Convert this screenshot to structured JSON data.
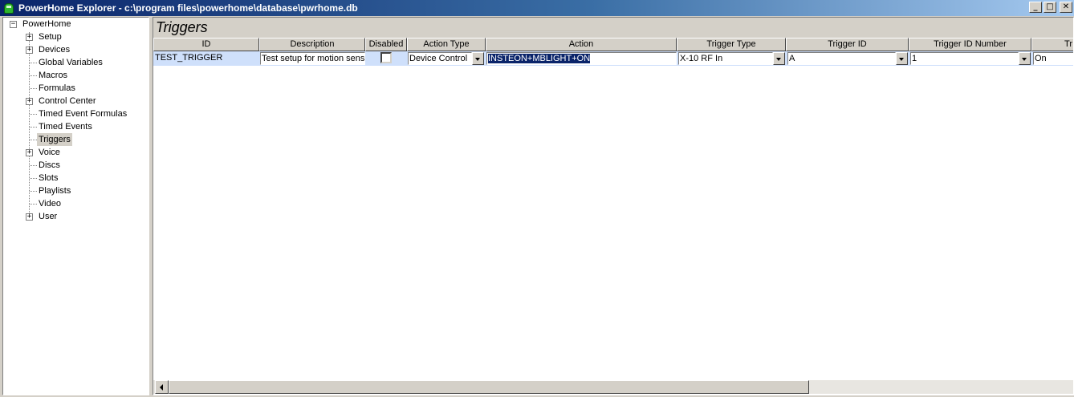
{
  "window": {
    "title": "PowerHome Explorer - c:\\program files\\powerhome\\database\\pwrhome.db",
    "minimize": "_",
    "maximize": "□",
    "close": "✕"
  },
  "tree": {
    "root": "PowerHome",
    "items": [
      {
        "label": "Setup",
        "expandable": true
      },
      {
        "label": "Devices",
        "expandable": true
      },
      {
        "label": "Global Variables",
        "expandable": false
      },
      {
        "label": "Macros",
        "expandable": false
      },
      {
        "label": "Formulas",
        "expandable": false
      },
      {
        "label": "Control Center",
        "expandable": true
      },
      {
        "label": "Timed Event Formulas",
        "expandable": false
      },
      {
        "label": "Timed Events",
        "expandable": false
      },
      {
        "label": "Triggers",
        "expandable": false,
        "selected": true
      },
      {
        "label": "Voice",
        "expandable": true
      },
      {
        "label": "Discs",
        "expandable": false
      },
      {
        "label": "Slots",
        "expandable": false
      },
      {
        "label": "Playlists",
        "expandable": false
      },
      {
        "label": "Video",
        "expandable": false
      },
      {
        "label": "User",
        "expandable": true
      }
    ]
  },
  "main": {
    "title": "Triggers",
    "columns": [
      "ID",
      "Description",
      "Disabled",
      "Action Type",
      "Action",
      "Trigger Type",
      "Trigger ID",
      "Trigger ID Number",
      "Tr"
    ],
    "row": {
      "id": "TEST_TRIGGER",
      "description": "Test setup for motion sensor",
      "disabled": false,
      "action_type": "Device Control",
      "action": "INSTEON+MBLIGHT+ON",
      "trigger_type": "X-10 RF In",
      "trigger_id": "A",
      "trigger_id_number": "1",
      "trigger_value": "On"
    }
  },
  "colors": {
    "title_start": "#0a246a",
    "title_end": "#a6caf0",
    "row_highlight": "#cfe0fb",
    "selection": "#0a246a"
  }
}
